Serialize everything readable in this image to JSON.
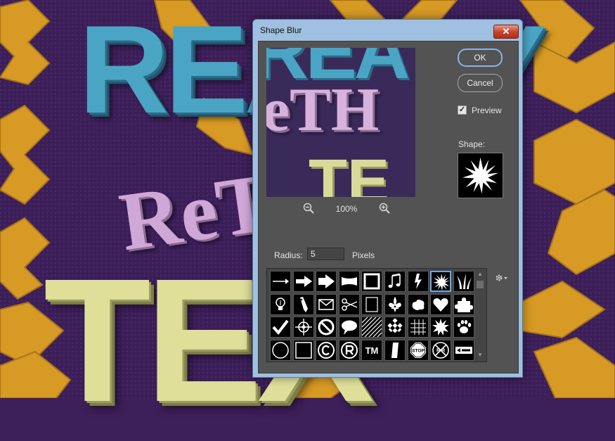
{
  "background": {
    "words": [
      "REALLY",
      "ReTHE",
      "TEX"
    ],
    "colors": {
      "purple": "#3d1f5a",
      "zigzag": "#d79a24",
      "blue": "#4aa5c4",
      "pink": "#d0a8d8",
      "yellow": "#dfdf9a"
    }
  },
  "dialog": {
    "title": "Shape Blur",
    "close_icon": "close-x-icon",
    "preview_words": [
      "REA",
      "eTH",
      "TE"
    ],
    "zoom_level": "100%",
    "radius": {
      "label": "Radius:",
      "value": "5",
      "unit": "Pixels",
      "slider_fraction": 0.025
    },
    "buttons": {
      "ok": "OK",
      "cancel": "Cancel"
    },
    "preview_checkbox": {
      "label": "Preview",
      "checked": true
    },
    "shape_label": "Shape:",
    "selected_shape": "starburst-shape",
    "shapes": [
      "arrow-thin-shape",
      "arrow-medium-shape",
      "arrow-bold-shape",
      "banner-shape",
      "frame-shape",
      "music-note-shape",
      "lightning-shape",
      "starburst-shape",
      "grass-shape",
      "lightbulb-shape",
      "pen-shape",
      "envelope-shape",
      "scissors-shape",
      "rectangle-frame-shape",
      "fleur-de-lis-shape",
      "ornament-shape",
      "heart-shape",
      "puzzle-shape",
      "checkmark-shape",
      "target-shape",
      "no-symbol-shape",
      "speech-bubble-shape",
      "diagonal-lines-shape",
      "checkerboard-shape",
      "grid-shape",
      "burst-shape",
      "paw-print-shape",
      "circle-shape",
      "square-shape",
      "copyright-shape",
      "registered-shape",
      "trademark-shape",
      "domino-shape",
      "stop-sign-shape",
      "railroad-sign-shape",
      "sign-shape"
    ],
    "shape_texts": {
      "trademark": "TM",
      "stop": "STOP",
      "rr": "R R"
    }
  }
}
